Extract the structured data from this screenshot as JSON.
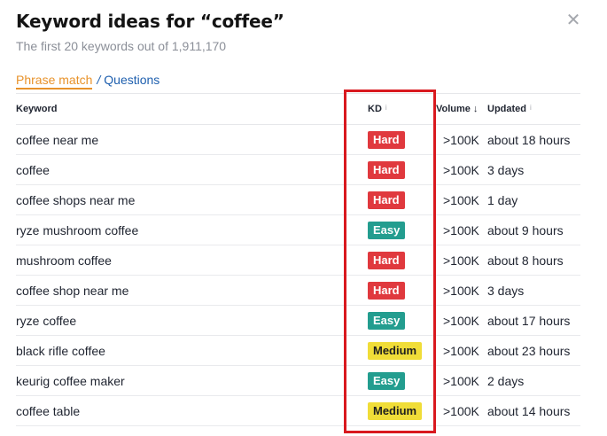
{
  "dialog": {
    "title": "Keyword ideas for “coffee”",
    "subtitle": "The first 20 keywords out of 1,911,170",
    "close_symbol": "✕"
  },
  "tabs": {
    "active": "Phrase match",
    "separator": "/",
    "other": "Questions"
  },
  "columns": {
    "keyword": "Keyword",
    "kd": "KD",
    "volume": "Volume",
    "updated": "Updated",
    "info_symbol": "i",
    "sort_symbol": "↓"
  },
  "rows": [
    {
      "keyword": "coffee near me",
      "kd": "Hard",
      "kd_level": "hard",
      "volume": ">100K",
      "updated": "about 18 hours"
    },
    {
      "keyword": "coffee",
      "kd": "Hard",
      "kd_level": "hard",
      "volume": ">100K",
      "updated": "3 days"
    },
    {
      "keyword": "coffee shops near me",
      "kd": "Hard",
      "kd_level": "hard",
      "volume": ">100K",
      "updated": "1 day"
    },
    {
      "keyword": "ryze mushroom coffee",
      "kd": "Easy",
      "kd_level": "easy",
      "volume": ">100K",
      "updated": "about 9 hours"
    },
    {
      "keyword": "mushroom coffee",
      "kd": "Hard",
      "kd_level": "hard",
      "volume": ">100K",
      "updated": "about 8 hours"
    },
    {
      "keyword": "coffee shop near me",
      "kd": "Hard",
      "kd_level": "hard",
      "volume": ">100K",
      "updated": "3 days"
    },
    {
      "keyword": "ryze coffee",
      "kd": "Easy",
      "kd_level": "easy",
      "volume": ">100K",
      "updated": "about 17 hours"
    },
    {
      "keyword": "black rifle coffee",
      "kd": "Medium",
      "kd_level": "medium",
      "volume": ">100K",
      "updated": "about 23 hours"
    },
    {
      "keyword": "keurig coffee maker",
      "kd": "Easy",
      "kd_level": "easy",
      "volume": ">100K",
      "updated": "2 days"
    },
    {
      "keyword": "coffee table",
      "kd": "Medium",
      "kd_level": "medium",
      "volume": ">100K",
      "updated": "about 14 hours"
    }
  ],
  "colors": {
    "hard": "#e0393e",
    "easy": "#239d8f",
    "medium": "#f0dd38",
    "active_tab": "#e8922a",
    "link": "#1e5fae",
    "highlight": "#d9191f"
  }
}
